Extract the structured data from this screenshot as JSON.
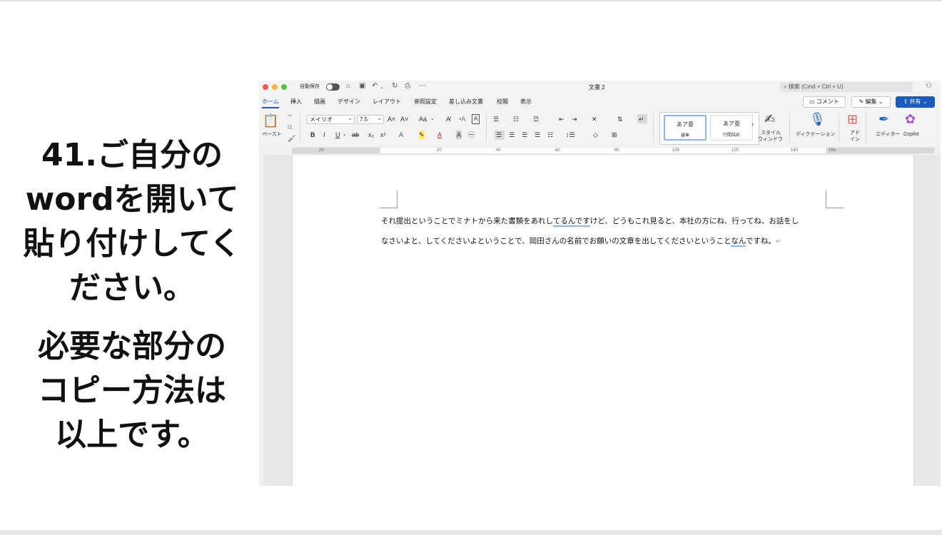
{
  "instructions": {
    "first": [
      "41.ご自分の",
      "wordを開いて",
      "貼り付けしてく",
      "ださい。"
    ],
    "second": [
      "必要な部分の",
      "コピー方法は",
      "以上です。"
    ]
  },
  "window": {
    "autosave_label": "自動保存",
    "doc_title": "文書 2",
    "search_placeholder": "検索 (Cmd + Ctrl + U)"
  },
  "tabs": [
    "ホーム",
    "挿入",
    "描画",
    "デザイン",
    "レイアウト",
    "参照設定",
    "差し込み文書",
    "校閲",
    "表示"
  ],
  "right_buttons": {
    "comment": "コメント",
    "edit": "編集",
    "share": "共有"
  },
  "ribbon": {
    "paste_label": "ペースト",
    "font_name": "メイリオ",
    "font_size": "7.5",
    "case_label": "Aa",
    "styles": [
      {
        "sample": "あア亜",
        "name": "標準"
      },
      {
        "sample": "あア亜",
        "name": "行間詰め"
      }
    ],
    "style_window": [
      "スタイル",
      "ウィンドウ"
    ],
    "dictation": "ディクテーション",
    "addin": [
      "アド",
      "イン"
    ],
    "editor": "エディター",
    "copilot": "Copilot"
  },
  "ruler_ticks": [
    "20",
    "20",
    "40",
    "60",
    "80",
    "100",
    "120",
    "140",
    "160"
  ],
  "document": {
    "line1_a": "それ提出ということでミナトから来た書類をあれし",
    "line1_u": "てるんです",
    "line1_b": "けど、どうもこれ見ると、本社の方にね、行ってね、お話をし",
    "line2_a": "なさいよと、してくださいよということで、岡田さんの名前でお願いの文章を出してくださいということ",
    "line2_u": "なん",
    "line2_b": "ですね。",
    "paragraph_mark": "↵"
  },
  "colors": {
    "accent": "#185abd",
    "close": "#ee5b52",
    "minimize": "#f3b53a",
    "zoom": "#4fc23c"
  }
}
